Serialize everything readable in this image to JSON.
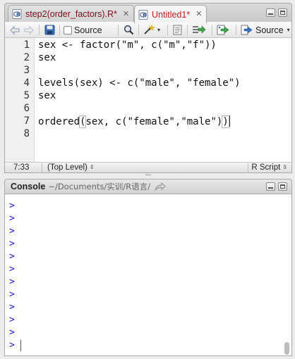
{
  "source_pane": {
    "tabs": [
      {
        "label": "step2(order_factors).R*",
        "active": false
      },
      {
        "label": "Untitled1*",
        "active": true
      }
    ],
    "toolbar": {
      "source_on_save_label": "Source",
      "source_button_label": "Source"
    },
    "editor": {
      "line_numbers": [
        "1",
        "2",
        "3",
        "4",
        "5",
        "6",
        "7",
        "8"
      ],
      "lines": [
        "sex <- factor(\"m\", c(\"m\",\"f\"))",
        "sex",
        "",
        "levels(sex) <- c(\"male\", \"female\")",
        "sex",
        "",
        "ordered",
        ""
      ],
      "line7_paren": "(",
      "line7_rest": "sex, c(\"female\",\"male\")",
      "line7_close": ")"
    },
    "status": {
      "cursor_position": "7:33",
      "scope": "(Top Level)",
      "file_type": "R Script"
    }
  },
  "console": {
    "title": "Console",
    "path": "~/Documents/实训/R语言/",
    "prompts": [
      ">",
      ">",
      ">",
      ">",
      ">",
      ">",
      ">",
      ">",
      ">",
      ">",
      ">",
      ">"
    ]
  },
  "colors": {
    "prompt_blue": "#1c20c6",
    "tab_active_text": "#c21d24"
  },
  "icons": [
    "r-file-icon",
    "close-icon",
    "back-arrow-icon",
    "forward-arrow-icon",
    "save-icon",
    "checkbox-icon",
    "magnifier-icon",
    "magic-wand-icon",
    "notes-icon",
    "run-line-icon",
    "rerun-icon",
    "source-arrow-icon",
    "goto-dir-icon",
    "minimize-icon",
    "maximize-icon"
  ]
}
